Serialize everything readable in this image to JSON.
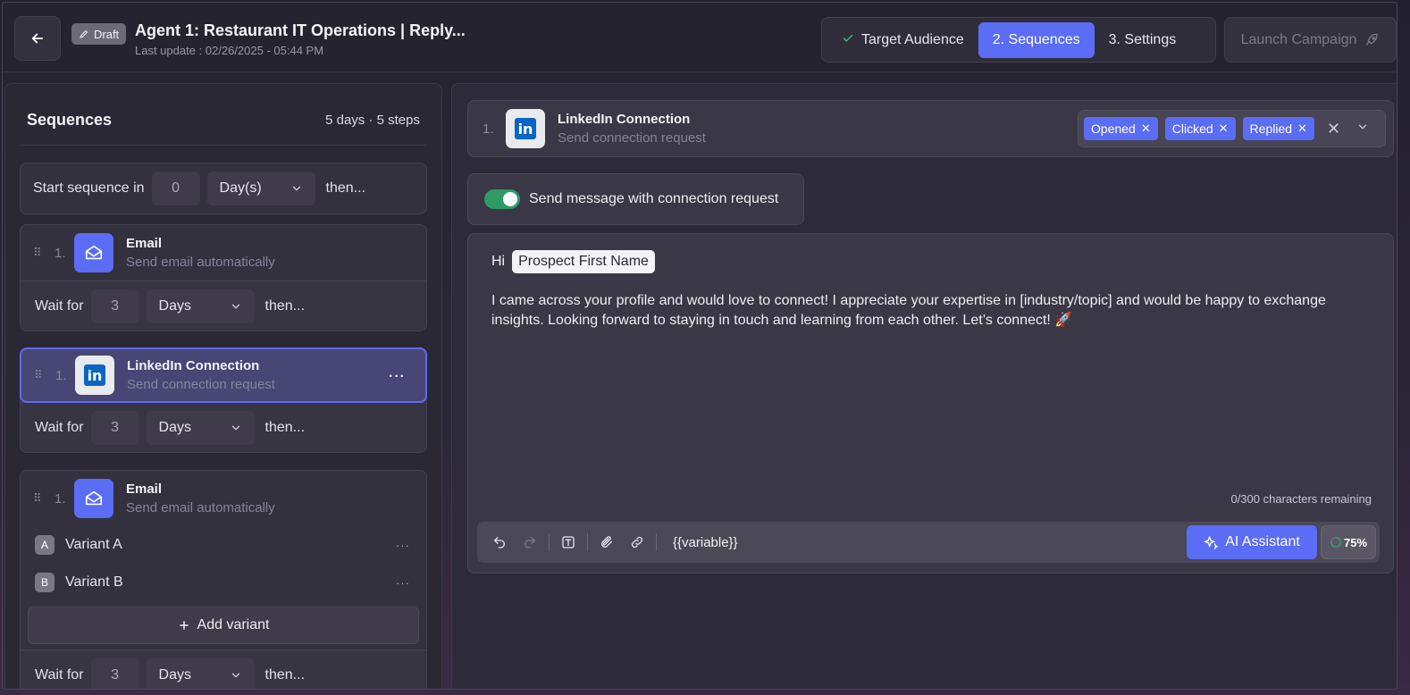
{
  "header": {
    "draft_label": "Draft",
    "title": "Agent 1: Restaurant IT Operations | Reply...",
    "last_update": "Last update : 02/26/2025 - 05:44 PM",
    "steps": [
      {
        "label": "Target Audience",
        "state": "completed"
      },
      {
        "label": "2. Sequences",
        "state": "active"
      },
      {
        "label": "3. Settings",
        "state": "inactive"
      }
    ],
    "launch_label": "Launch Campaign"
  },
  "sequences": {
    "title": "Sequences",
    "meta": "5 days · 5 steps",
    "start": {
      "prefix": "Start sequence in",
      "value": "0",
      "unit": "Day(s)",
      "suffix": "then..."
    },
    "items": [
      {
        "number": "1.",
        "type": "email",
        "name": "Email",
        "desc": "Send email automatically",
        "wait": {
          "label": "Wait for",
          "value": "3",
          "unit": "Days",
          "suffix": "then..."
        }
      },
      {
        "number": "1.",
        "type": "linkedin",
        "name": "LinkedIn Connection",
        "desc": "Send connection request",
        "wait": {
          "label": "Wait for",
          "value": "3",
          "unit": "Days",
          "suffix": "then..."
        }
      },
      {
        "number": "1.",
        "type": "email",
        "name": "Email",
        "desc": "Send email automatically",
        "variants": [
          {
            "badge": "A",
            "label": "Variant A"
          },
          {
            "badge": "B",
            "label": "Variant B"
          }
        ],
        "add_variant_label": "Add variant",
        "wait": {
          "label": "Wait for",
          "value": "3",
          "unit": "Days",
          "suffix": "then..."
        }
      }
    ]
  },
  "detail": {
    "number": "1.",
    "name": "LinkedIn Connection",
    "desc": "Send connection request",
    "tags": [
      "Opened",
      "Clicked",
      "Replied"
    ],
    "toggle_label": "Send message with connection request",
    "toggle_on": true,
    "greeting": "Hi",
    "variable_chip": "Prospect First Name",
    "message": "I came across your profile and would love to connect! I appreciate your expertise in [industry/topic] and would be happy to exchange insights. Looking forward to staying in touch and learning from each other. Let’s connect! 🚀",
    "char_count": "0/300 characters remaining",
    "variable_button": "{{variable}}",
    "ai_label": "AI Assistant",
    "score": "75%"
  },
  "colors": {
    "accent": "#5b6cf5",
    "success": "#2e9b67",
    "linkedin": "#0a66c2"
  }
}
